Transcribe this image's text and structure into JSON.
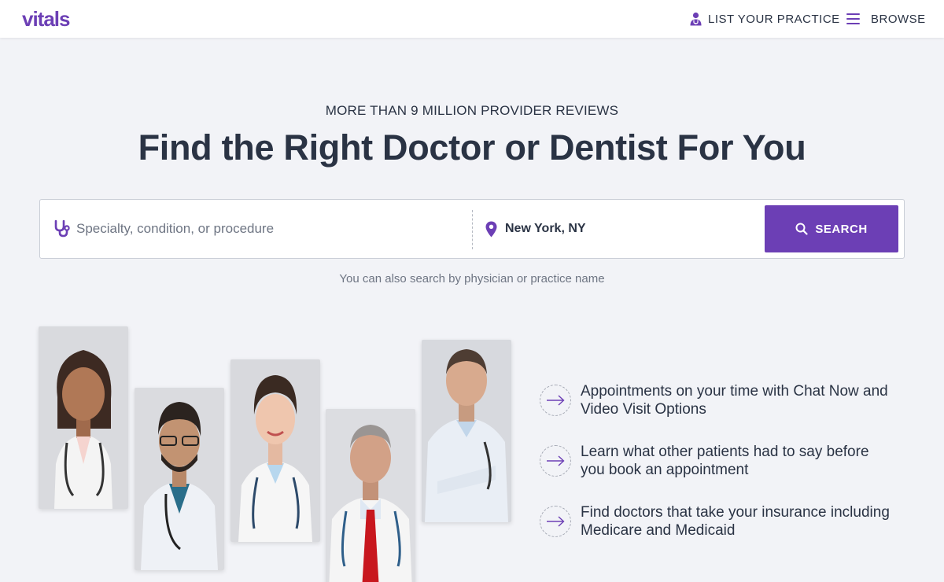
{
  "header": {
    "logo": "vitals",
    "list_practice": "LIST YOUR PRACTICE",
    "browse": "BROWSE"
  },
  "hero": {
    "eyebrow": "MORE THAN 9 MILLION PROVIDER REVIEWS",
    "headline": "Find the Right Doctor or Dentist For You"
  },
  "search": {
    "specialty_placeholder": "Specialty, condition, or procedure",
    "specialty_value": "",
    "location_value": "New York, NY",
    "button_label": "SEARCH",
    "hint": "You can also search by physician or practice name"
  },
  "features": [
    {
      "text": "Appointments on your time with Chat Now and Video Visit Options"
    },
    {
      "text": "Learn what other patients had to say before you book an appointment"
    },
    {
      "text": "Find doctors that take your insurance including Medicare and Medicaid"
    }
  ],
  "colors": {
    "brand": "#6c3fb5",
    "text": "#2a3344",
    "muted": "#6e7583",
    "background": "#f2f3f7"
  },
  "icons": {
    "list_practice": "doctor-icon",
    "browse": "hamburger-menu-icon",
    "specialty": "stethoscope-icon",
    "location": "map-pin-icon",
    "search": "magnifier-icon",
    "feature": "arrow-right-icon"
  }
}
